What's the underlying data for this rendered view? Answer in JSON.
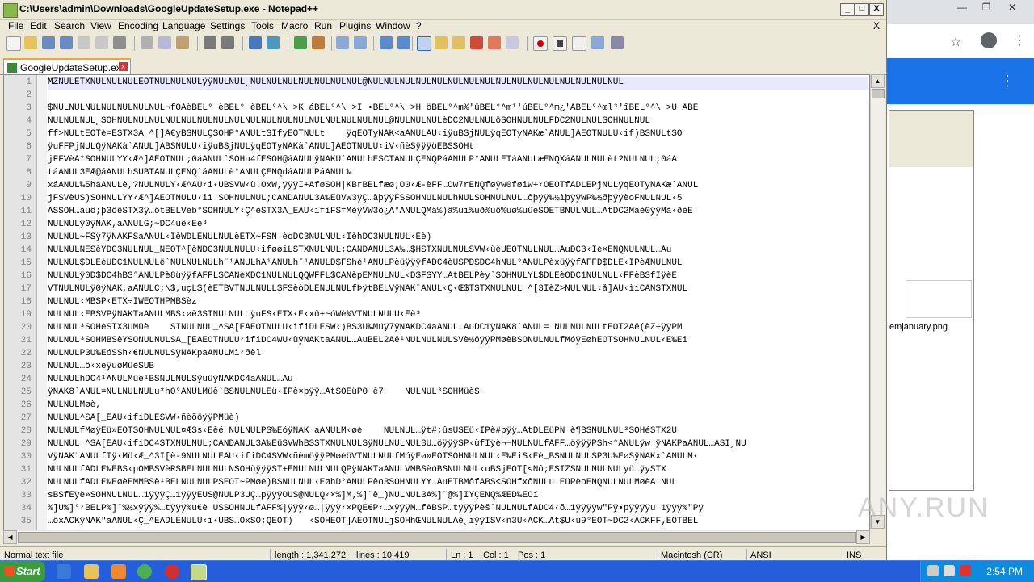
{
  "window": {
    "title": "C:\\Users\\admin\\Downloads\\GoogleUpdateSetup.exe - Notepad++",
    "minimize": "_",
    "maximize": "□",
    "close": "X"
  },
  "menu": [
    "File",
    "Edit",
    "Search",
    "View",
    "Encoding",
    "Language",
    "Settings",
    "Tools",
    "Macro",
    "Run",
    "Plugins",
    "Window",
    "?"
  ],
  "menu_close": "X",
  "toolbar_icons": [
    "new-icon",
    "open-icon",
    "save-icon",
    "save-all-icon",
    "close-icon",
    "close-all-icon",
    "print-icon",
    "cut-icon",
    "copy-icon",
    "paste-icon",
    "undo-icon",
    "redo-icon",
    "find-icon",
    "replace-icon",
    "zoom-in-icon",
    "zoom-out-icon",
    "sync-v-icon",
    "sync-h-icon",
    "word-wrap-icon",
    "all-chars-icon",
    "indent-guide-icon",
    "udl-icon",
    "doc-map-icon",
    "function-list-icon",
    "folder-workspace-icon",
    "monitor-icon",
    "record-icon",
    "stop-icon",
    "play-icon",
    "play-multi-icon",
    "save-macro-icon"
  ],
  "tab": {
    "label": "GoogleUpdateSetup.exe",
    "close": "x"
  },
  "editor": {
    "line_numbers": [
      "1",
      "2",
      "3",
      "4",
      "5",
      "6",
      "7",
      "8",
      "9",
      "10",
      "11",
      "12",
      "13",
      "14",
      "15",
      "16",
      "17",
      "18",
      "19",
      "20",
      "21",
      "22",
      "23",
      "24",
      "25",
      "26",
      "27",
      "28",
      "29",
      "30",
      "31",
      "32",
      "33",
      "34",
      "35"
    ],
    "lines": [
      "MZNULETXNULNULNULEOTNULNULNULÿÿNULNUL¸NULNULNULNULNULNULNUL@NULNULNULNULNULNULNULNULNULNULNULNULNULNULNULNUL",
      "",
      "$NULNULNULNULNULNULNUL¬fÕÀèBEL°¯èBEL°¯èBEL°^\\ >K¯áBEL°^\\ >I¯•BEL°^\\ >H¯öBEL°^m%'ûBEL°^m¹'úBEL°^m¿'ÃBEL°^œl³'îBEL°^\\ >U¯ÃBE",
      "NULNULNUL¸SOHNULNULNULNULNULNULNULNULNULNULNULNULNULNULNULNULNUL@NULNULNULèDC2NULNULöSOHNULNULFDC2NULNULSOHNULNUL",
      "ff>NULtEOTè=ESTX3À_^[]Ã€yBSNULÇSOHP°ANULtSIfyEOTNULt    ÿqEOTyNAK<aANULÃU‹iÿuBSjNULÿqEOTyNAKæ`ANUL]ÃEOTNULU‹if)BSNULtSO",
      "ÿuFFPjNULQÿNAKà`ANUL]ÃBSNULU‹iÿuBSjNULÿqEOTyNAKà`ANUL]ÃEOTNULU‹iV‹ñèSÿÿÿöEBSSOHt",
      "jFFVèÁ°SOHNULYY‹Æ^]ÃEOTNUL;0áANUL`SOHu4fÈSOH@áANULÿNAKÙ`ANULhESCTANULÇENQPáANULP°ANULÈTáANULæENQXáANULNULèt?NULNUL;0áA",
      "táANUL3ÉÆ@áANULhSUBTANULÇENQ`áANULè°ANULÇENQdáANULPáANUL‰",
      "xáANUL‰5háANULè,?NULNULY‹Æ^ÃU‹i‹UBSVW‹ù.ÒxW,ÿÿÿI+ÂføSOH|KBrBELfæø;Ö0‹Æ-èFF…Ôw7rENQføÿw0føiw+‹OEOTfÀDLEPjNULÿqEOTyNAKæ`ANUL",
      "jFSVèUS)SOHNULYY‹Æ^]ÃEOTNULU‹iì SOHNULNUL;CANDANUL3Ã‰EüVW3ÿÇ…àþÿÿFSSOHNULNULhNULSOHNULNUL…ôþÿÿ‰½ìþÿÿWP‰½ðþÿÿèoFNULNUL‹5",
      "ÀŠSOH…àuô;þ3öëSTX3ÿ…ötBELVèb°SOHNULY‹Ç^èSTX3À_ÉÃU‹ìfìFSfMèÿVW3ö¿À°ANULQMä%)ä%ui%uð%uô%uø%uüèSOETBNULNUL…ÀtDC2Màè0ÿÿMà‹ðèE",
      "NULNULÿ0ÿNAK,aANULG;~DC4uê‹Ëè³",
      "NULNUL~FSÿ7ÿNAKFSaANUL‹ÎèWDLENULNULèETX~FSN èoDC3NULNUL‹ÎèhDC3NULNUL‹Èè)",
      "NULNULNESèÝDC3NULNUL_NEOT^[èNDC3NULNULU‹iføøiLSTXNULNUL;CANDANUL3Ä‰…$HSTXNULNULSVW‹ùèÙEOTNULNUL…ÀuDC3‹Îè×ENQNULNUL…Àu",
      "NULNUL$DLEèÜDC1NULNULë`NULNULNULh¨¹ANULhÄ¹ANULh¨¹ANULD$FShè¹ANULPèüÿÿÿfÀDC4èUSPD$DC4hNUL°ANULPèxüÿÿfÀFFD$DLE‹ÎPèÆNULNUL",
      "NULNULÿ0D$DC4hBS°ANULPè8üÿÿfÀFFL$CANèXDC1NULNULQQWFFL$CANèpEMNULNUL‹D$FSYY…ÀtBELPèy`SOHNULYL$DLEèODC1NULNUL‹FFèBSfÏÿèE",
      "VTNULNULÿ0ÿNAK,aANULC;\\$,uçL$(èETBVTNULNULL$FSèòDLENULNULfÞÿtBELVÿNAK¨ANUL‹Ç‹Œ$TSTXNULNUL_^[3ÌèŽ>NULNUL‹å]ÃU‹ìiCANSTXNUL",
      "NULNUL‹MBSP‹ETX÷ÌWEOTHPMBSèz",
      "NULNUL‹EBSVPÿNAKTaANULMBS‹øè3SINULNUL…ÿuFS‹ETX‹Ë‹xô+~óWè¾VTNULNULU‹Èè³",
      "NULNUL³SOHèSTX3ÛMüè    SINULNUL_^ŠÃ[ÉÃEOTNULU‹ifiDLESW‹)BS3Û‰Müÿ7ÿNAKDC4aANUL…ÀuDC1ÿNAK8`ANUL= NULNULNULtEOT2Àë(èZ÷ÿÿPM",
      "NULNUL³SOHMBSèYSONULNULŠÃ_[ÉÃEOTNULU‹ifiDC4WU‹ùÿNAKtaANUL…ÀuBEL2Àë¹NULNULNULSVè½öÿÿPMøèBSONULNULfMóÿEøhEOTSOHNULNUL‹È‰Ei",
      "NULNULP3Û‰EóSSh‹€NULNULSÿNAKpaANULMì‹ðèl",
      "NULNUL…ö‹xeÿuøMüèSUB",
      "NULNULhDC4¹ANULMüè¹BSNULNULSÿuüÿNAKDC4aANUL…Àu",
      "ÿNAK8`ANUL=NULNULNULu*hO°ANULMüè`BSNULNULEü‹ÎPè×þÿÿ…ÀtSOEüPO è7    NULNUL³SOHMüèŠ",
      "NULNULMøè,",
      "NULNUL^ŠÃ[_ÉÃU‹ifiDLESVW‹ñèõöÿÿPMüè)",
      "NULNULfMøÿEü»EOTSOHNULNUL¤ÆSs‹Èèé NULNULPS‰EóÿNAK aANULM‹øè¯   NULNUL…ÿt#;ûsUSEü‹ÎPè#þÿÿ…ÀtDLEüPN è¶BSNULNUL³SOHéSTX2Û",
      "NULNUL_^ŠÃ[ÉÃU‹ifiDC4STXNULNUL;CANDANUL3Ä‰EüSVWhBSSTXNULNULSÿNULNULNUL3Û…öÿÿÿSP‹ùfÏÿè¬¬NULNULfÀFF…öÿÿÿPSh<°ANULÿw ÿNAKPaANUL…ÀSI¸NU",
      "VÿNAK¨ANULfÏÿ‹Mü‹Æ_^3Í[è-9NULNULÉÃU‹ifiDC4SVW‹ñèmöÿÿPMøèöVTNULNULfMóÿEø»EOTSOHNULNUL‹È‰EiS‹Èè_BSNULNULSP3Û‰EøSÿNAKx`ANULM‹",
      "NULNULfÀDLE‰EBS‹pÕMBSVèRSBELNULNULNSOHùÿÿÿST+ÊNULNULNULQPÿNAKTaANULVMBSèóBSNULNUL‹uBSjEOT[<Nô;ESIŽSNULNULNULyü…ÿySTX",
      "NULNULfÀDLE‰EøèËMMBSè¹BELNULNULPSEOT~PMøè)BSNULNUL‹EøhD°ANULPèo3SOHNULYY…ÀuETBMôfÀBS<SOHfxôNULu EüPèoENQNULNULMøèÀ NUL",
      "sBSfÈÿè»SOHNULNUL…1ÿÿÿÇ…1ÿÿÿÈUS@NULP3ÛÇ…pÿÿÿÔUS@NULQ‹×%]M‚%]˜è_)NULNUL3À%]˜@%]ÏŸÇENQ%ÆÈD‰ÈÓí",
      "%]Ú%]°‹BELP%]˜%½xÿÿÿ%…tÿÿÿ%u€è USSOHNULfÀFF%|ÿÿÿ‹ø…|ÿÿÿ‹×PQE€P‹…xÿÿÿM…fÀBSP…tÿÿÿPèš`NULNULfÀDC4‹õ…1ÿÿÿÿw\"Pÿ•pÿÿÿÿu¯1ÿÿÿ%\"Pÿ",
      "…öxACKÿNAK\"aANUL‹Ç_^ÈÃDLENULU‹i‹UBS…ÒxSO;QEOT)   ‹SOHEOT]ÃEOTNULjSOHhŒNULNULÂè¸iÿÿÌSV‹ñ3Û‹ACK…Àt$Ü‹ù9°EOT~DC2‹ACKFF‚EOTBEL"
    ]
  },
  "status": {
    "type": "Normal text file",
    "length": "length : 1,341,272",
    "lines": "lines : 10,419",
    "ln": "Ln : 1",
    "col": "Col : 1",
    "pos": "Pos : 1",
    "eol": "Macintosh (CR)",
    "encoding": "ANSI",
    "ins": "INS"
  },
  "background": {
    "explorer_file": "emjanuary.png"
  },
  "taskbar": {
    "start": "Start",
    "clock": "2:54 PM"
  },
  "watermark": "ANY.RUN"
}
